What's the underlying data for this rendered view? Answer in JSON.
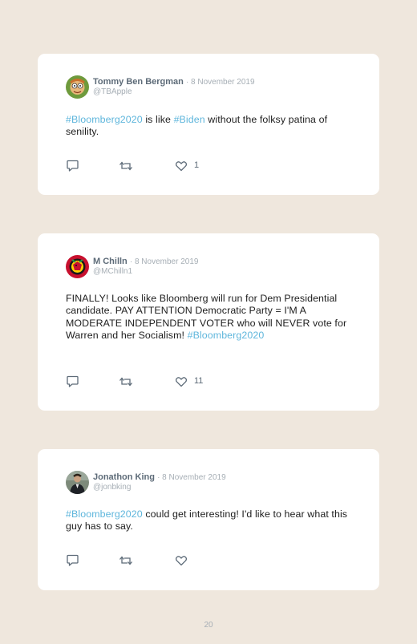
{
  "tweets": [
    {
      "name": "Tommy Ben Bergman",
      "date": "· 8 November 2019",
      "handle": "@TBApple",
      "text": [
        {
          "t": "#Bloomberg2020",
          "tag": true
        },
        {
          "t": " is like ",
          "tag": false
        },
        {
          "t": "#Biden",
          "tag": true
        },
        {
          "t": " without the folksy patina of senility.",
          "tag": false
        }
      ],
      "likes": "1",
      "avatar_icon": "cartoon-face-avatar"
    },
    {
      "name": "M Chilln",
      "date": "· 8 November 2019",
      "handle": "@MChilln1",
      "text": [
        {
          "t": "FINALLY! Looks like Bloomberg will run for Dem Presidential candidate. PAY ATTENTION Democratic Party = I'M A MODERATE INDEPENDENT VOTER who will NEVER vote for Warren and her Socialism! ",
          "tag": false
        },
        {
          "t": "#Bloomberg2020",
          "tag": true
        }
      ],
      "likes": "11",
      "avatar_icon": "hockey-logo-avatar"
    },
    {
      "name": "Jonathon King",
      "date": "· 8 November 2019",
      "handle": "@jonbking",
      "text": [
        {
          "t": "#Bloomberg2020",
          "tag": true
        },
        {
          "t": " could get interesting! I'd like to hear what this guy has to say.",
          "tag": false
        }
      ],
      "likes": "",
      "avatar_icon": "person-photo-avatar"
    }
  ],
  "page_number": "20",
  "colors": {
    "background": "#efe7dd",
    "card": "#ffffff",
    "hashtag": "#5fb6dc",
    "name": "#5d6b78",
    "muted": "#a6aeb5"
  }
}
